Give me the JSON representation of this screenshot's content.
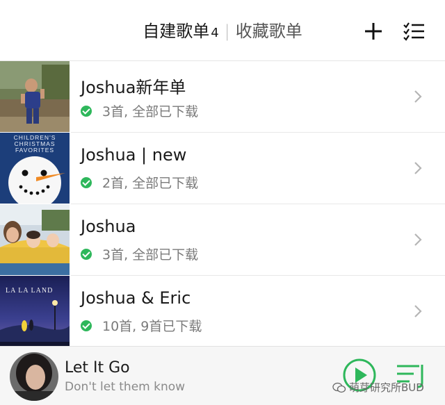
{
  "header": {
    "tab_own_label": "自建歌单",
    "tab_own_count": "4",
    "tab_separator": "|",
    "tab_fav_label": "收藏歌单",
    "add_icon": "plus-icon",
    "manage_icon": "checklist-icon"
  },
  "playlists": [
    {
      "title": "Joshua新年单",
      "status": "3首, 全部已下载",
      "cover": "photo-boy-in-garden"
    },
    {
      "title": "Joshua | new",
      "status": "2首, 全部已下载",
      "cover": "childrens-christmas-favorites-snowman",
      "cover_text": [
        "CHILDREN'S",
        "CHRISTMAS",
        "FAVORITES"
      ]
    },
    {
      "title": "Joshua",
      "status": "3首, 全部已下载",
      "cover": "photo-family-on-ride"
    },
    {
      "title": "Joshua & Eric",
      "status": "10首, 9首已下载",
      "cover": "la-la-land-poster",
      "cover_text": [
        "LA LA LAND"
      ]
    }
  ],
  "player": {
    "song_title": "Let It Go",
    "lyric": "Don't let them know",
    "avatar": "singer-portrait",
    "play_icon": "play-circle-icon",
    "queue_icon": "playlist-icon"
  },
  "watermark": {
    "text": "萌芽研究所BUD",
    "icon": "wechat-icon"
  },
  "colors": {
    "accent_green": "#2eb75b",
    "player_bar": "#f6f6f6",
    "status_gray": "#7a7a7a"
  }
}
